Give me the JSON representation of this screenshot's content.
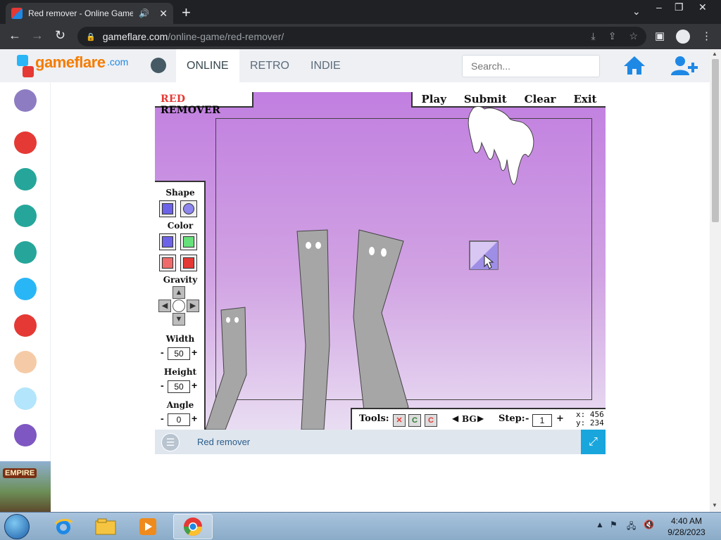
{
  "browser": {
    "tab_title": "Red remover - Online Game",
    "url_host": "gameflare.com",
    "url_path": "/online-game/red-remover/",
    "new_tab_label": "+"
  },
  "site": {
    "logo_text": "gameflare",
    "logo_suffix": ".com",
    "nav_tabs": [
      "ONLINE",
      "RETRO",
      "INDIE"
    ],
    "active_tab": "ONLINE",
    "search_placeholder": "Search...",
    "side_promo": "EMPIRE"
  },
  "game": {
    "title_red": "RED",
    "title_rest": " REMOVER",
    "menu": [
      "Play",
      "Submit",
      "Clear",
      "Exit"
    ],
    "panel": {
      "shape_label": "Shape",
      "color_label": "Color",
      "gravity_label": "Gravity",
      "width_label": "Width",
      "width_value": "50",
      "height_label": "Height",
      "height_value": "50",
      "angle_label": "Angle",
      "angle_value": "0",
      "minus": "-",
      "plus": "+"
    },
    "bottom": {
      "tools_label": "Tools:",
      "bg_label": "BG",
      "step_label": "Step:",
      "step_value": "1",
      "coord_x": "x: 456",
      "coord_y": "y: 234"
    },
    "footer_title": "Red remover"
  },
  "colors": {
    "swatch_blue": "#6c63e8",
    "swatch_green": "#66e07a",
    "swatch_pink": "#ef6b6b",
    "swatch_red": "#e53935",
    "accent": "#18a6dc"
  },
  "taskbar": {
    "time": "4:40 AM",
    "date": "9/28/2023"
  }
}
